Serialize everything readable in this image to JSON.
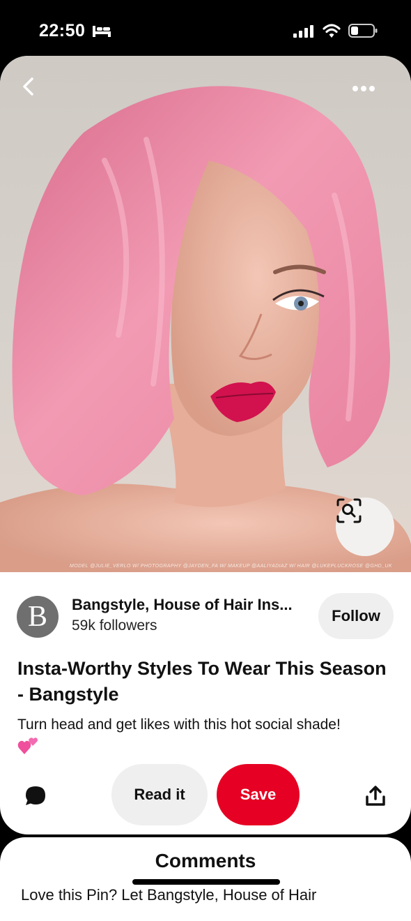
{
  "status_bar": {
    "time": "22:50"
  },
  "pin": {
    "image_credit": "MODEL @JULIE_VERLO W/ PHOTOGRAPHY @JAYDEN_FA W/ MAKEUP @AALIYADIAZ W/ HAIR @LUKEPLUCKROSE @GHD_UK",
    "creator": {
      "avatar_letter": "B",
      "name": "Bangstyle, House of Hair Ins...",
      "followers": "59k followers",
      "follow_label": "Follow"
    },
    "title": "Insta-Worthy Styles To Wear This Season - Bangstyle",
    "description": "Turn head and get likes with this hot social shade!"
  },
  "actions": {
    "read_label": "Read it",
    "save_label": "Save"
  },
  "comments": {
    "title": "Comments",
    "preview": "Love this Pin? Let Bangstyle, House of Hair"
  },
  "colors": {
    "save": "#e60023",
    "button_gray": "#efefef"
  },
  "icons": [
    "bed-icon",
    "signal-icon",
    "wifi-icon",
    "battery-icon",
    "back-icon",
    "more-icon",
    "visual-search-icon",
    "comment-icon",
    "share-icon",
    "sparkling-heart-emoji"
  ]
}
